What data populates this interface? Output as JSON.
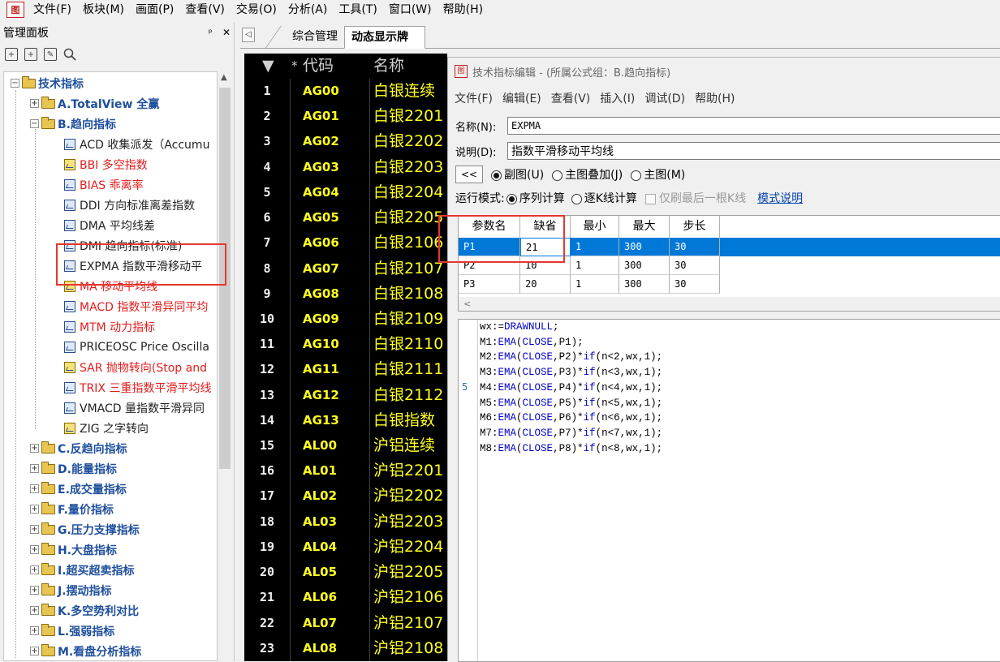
{
  "menubar": {
    "app_icon": "图",
    "items": [
      "文件(F)",
      "板块(M)",
      "画面(P)",
      "查看(V)",
      "交易(O)",
      "分析(A)",
      "工具(T)",
      "窗口(W)",
      "帮助(H)"
    ]
  },
  "panel": {
    "title": "管理面板",
    "pin": "ᵖ",
    "close": "✕",
    "tree": {
      "root": "技术指标",
      "folders_top": [
        "A.TotalView 全赢",
        "B.趋向指标"
      ],
      "b_items": [
        {
          "label": "ACD 收集派发（Accumu",
          "style": "normal",
          "colored": false
        },
        {
          "label": "BBI 多空指数",
          "style": "red",
          "colored": true
        },
        {
          "label": "BIAS 乖离率",
          "style": "red",
          "colored": false
        },
        {
          "label": "DDI 方向标准离差指数",
          "style": "normal",
          "colored": false
        },
        {
          "label": "DMA 平均线差",
          "style": "normal",
          "colored": false
        },
        {
          "label": "DMI 趋向指标(标准)",
          "style": "normal",
          "colored": false
        },
        {
          "label": "EXPMA 指数平滑移动平",
          "style": "normal",
          "colored": false
        },
        {
          "label": "MA 移动平均线",
          "style": "red",
          "colored": true
        },
        {
          "label": "MACD 指数平滑异同平均",
          "style": "red",
          "colored": false
        },
        {
          "label": "MTM 动力指标",
          "style": "red",
          "colored": false
        },
        {
          "label": "PRICEOSC Price Oscilla",
          "style": "normal",
          "colored": false
        },
        {
          "label": "SAR 抛物转向(Stop and",
          "style": "red",
          "colored": true
        },
        {
          "label": "TRIX 三重指数平滑平均线",
          "style": "red",
          "colored": false
        },
        {
          "label": "VMACD 量指数平滑异同",
          "style": "normal",
          "colored": false
        },
        {
          "label": "ZIG 之字转向",
          "style": "normal",
          "colored": true
        }
      ],
      "folders_rest": [
        "C.反趋向指标",
        "D.能量指标",
        "E.成交量指标",
        "F.量价指标",
        "G.压力支撑指标",
        "H.大盘指标",
        "I.超买超卖指标",
        "J.摆动指标",
        "K.多空势利对比",
        "L.强弱指标",
        "M.看盘分析指标"
      ]
    }
  },
  "tabs": {
    "scroll_left": "◁",
    "items": [
      "综合管理",
      "动态显示牌"
    ]
  },
  "quote": {
    "headers": {
      "sort": "▼",
      "star": "*",
      "code": "代码",
      "name": "名称"
    },
    "rows": [
      {
        "num": "1",
        "code": "AG00",
        "name": "白银连续"
      },
      {
        "num": "2",
        "code": "AG01",
        "name": "白银2201"
      },
      {
        "num": "3",
        "code": "AG02",
        "name": "白银2202"
      },
      {
        "num": "4",
        "code": "AG03",
        "name": "白银2203"
      },
      {
        "num": "5",
        "code": "AG04",
        "name": "白银2204"
      },
      {
        "num": "6",
        "code": "AG05",
        "name": "白银2205"
      },
      {
        "num": "7",
        "code": "AG06",
        "name": "白银2106"
      },
      {
        "num": "8",
        "code": "AG07",
        "name": "白银2107"
      },
      {
        "num": "9",
        "code": "AG08",
        "name": "白银2108"
      },
      {
        "num": "10",
        "code": "AG09",
        "name": "白银2109"
      },
      {
        "num": "11",
        "code": "AG10",
        "name": "白银2110"
      },
      {
        "num": "12",
        "code": "AG11",
        "name": "白银2111"
      },
      {
        "num": "13",
        "code": "AG12",
        "name": "白银2112"
      },
      {
        "num": "14",
        "code": "AG13",
        "name": "白银指数"
      },
      {
        "num": "15",
        "code": "AL00",
        "name": "沪铝连续"
      },
      {
        "num": "16",
        "code": "AL01",
        "name": "沪铝2201"
      },
      {
        "num": "17",
        "code": "AL02",
        "name": "沪铝2202"
      },
      {
        "num": "18",
        "code": "AL03",
        "name": "沪铝2203"
      },
      {
        "num": "19",
        "code": "AL04",
        "name": "沪铝2204"
      },
      {
        "num": "20",
        "code": "AL05",
        "name": "沪铝2205"
      },
      {
        "num": "21",
        "code": "AL06",
        "name": "沪铝2106"
      },
      {
        "num": "22",
        "code": "AL07",
        "name": "沪铝2107"
      },
      {
        "num": "23",
        "code": "AL08",
        "name": "沪铝2108"
      }
    ]
  },
  "editor": {
    "title": "技术指标编辑 - (所属公式组：B.趋向指标)",
    "icon": "图",
    "menu": [
      "文件(F)",
      "编辑(E)",
      "查看(V)",
      "插入(I)",
      "调试(D)",
      "帮助(H)"
    ],
    "name_label": "名称(N):",
    "name_value": "EXPMA",
    "desc_label": "说明(D):",
    "desc_value": "指数平滑移动平均线",
    "back_button": "<<",
    "display_options": [
      "副图(U)",
      "主图叠加(J)",
      "主图(M)"
    ],
    "run_mode_label": "运行模式:",
    "run_modes": [
      "序列计算",
      "逐K线计算"
    ],
    "only_last_bar": "仅刷最后一根K线",
    "mode_help_link": "模式说明",
    "params": {
      "headers": [
        "参数名",
        "缺省",
        "最小",
        "最大",
        "步长"
      ],
      "rows": [
        [
          "P1",
          "21",
          "1",
          "300",
          "30"
        ],
        [
          "P2",
          "10",
          "1",
          "300",
          "30"
        ],
        [
          "P3",
          "20",
          "1",
          "300",
          "30"
        ]
      ],
      "scroll_hint": "<"
    },
    "gutter_marker": "5",
    "code": [
      [
        {
          "t": "wx:="
        },
        {
          "t": "DRAWNULL",
          "k": 1
        },
        {
          "t": ";"
        }
      ],
      [
        {
          "t": "M1:"
        },
        {
          "t": "EMA",
          "k": 1
        },
        {
          "t": "("
        },
        {
          "t": "CLOSE",
          "k": 1
        },
        {
          "t": ",P1);"
        }
      ],
      [
        {
          "t": "M2:"
        },
        {
          "t": "EMA",
          "k": 1
        },
        {
          "t": "("
        },
        {
          "t": "CLOSE",
          "k": 1
        },
        {
          "t": ",P2)*"
        },
        {
          "t": "if",
          "k": 1
        },
        {
          "t": "(n<2,wx,1);"
        }
      ],
      [
        {
          "t": "M3:"
        },
        {
          "t": "EMA",
          "k": 1
        },
        {
          "t": "("
        },
        {
          "t": "CLOSE",
          "k": 1
        },
        {
          "t": ",P3)*"
        },
        {
          "t": "if",
          "k": 1
        },
        {
          "t": "(n<3,wx,1);"
        }
      ],
      [
        {
          "t": "M4:"
        },
        {
          "t": "EMA",
          "k": 1
        },
        {
          "t": "("
        },
        {
          "t": "CLOSE",
          "k": 1
        },
        {
          "t": ",P4)*"
        },
        {
          "t": "if",
          "k": 1
        },
        {
          "t": "(n<4,wx,1);"
        }
      ],
      [
        {
          "t": "M5:"
        },
        {
          "t": "EMA",
          "k": 1
        },
        {
          "t": "("
        },
        {
          "t": "CLOSE",
          "k": 1
        },
        {
          "t": ",P5)*"
        },
        {
          "t": "if",
          "k": 1
        },
        {
          "t": "(n<5,wx,1);"
        }
      ],
      [
        {
          "t": "M6:"
        },
        {
          "t": "EMA",
          "k": 1
        },
        {
          "t": "("
        },
        {
          "t": "CLOSE",
          "k": 1
        },
        {
          "t": ",P6)*"
        },
        {
          "t": "if",
          "k": 1
        },
        {
          "t": "(n<6,wx,1);"
        }
      ],
      [
        {
          "t": "M7:"
        },
        {
          "t": "EMA",
          "k": 1
        },
        {
          "t": "("
        },
        {
          "t": "CLOSE",
          "k": 1
        },
        {
          "t": ",P7)*"
        },
        {
          "t": "if",
          "k": 1
        },
        {
          "t": "(n<7,wx,1);"
        }
      ],
      [
        {
          "t": "M8:"
        },
        {
          "t": "EMA",
          "k": 1
        },
        {
          "t": "("
        },
        {
          "t": "CLOSE",
          "k": 1
        },
        {
          "t": ",P8)*"
        },
        {
          "t": "if",
          "k": 1
        },
        {
          "t": "(n<8,wx,1);"
        }
      ]
    ]
  }
}
